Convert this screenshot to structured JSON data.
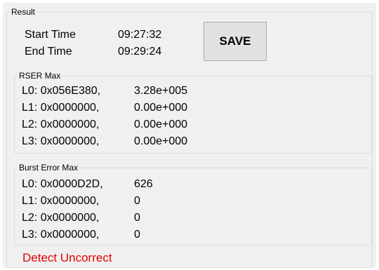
{
  "result": {
    "legend": "Result",
    "start_label": "Start Time",
    "start_value": "09:27:32",
    "end_label": "End Time",
    "end_value": "09:29:24",
    "save_label": "SAVE"
  },
  "rser": {
    "legend": "RSER Max",
    "rows": [
      {
        "addr": "L0: 0x056E380,",
        "value": "3.28e+005"
      },
      {
        "addr": "L1: 0x0000000,",
        "value": "0.00e+000"
      },
      {
        "addr": "L2: 0x0000000,",
        "value": "0.00e+000"
      },
      {
        "addr": "L3: 0x0000000,",
        "value": "0.00e+000"
      }
    ]
  },
  "burst": {
    "legend": "Burst Error Max",
    "rows": [
      {
        "addr": "L0: 0x0000D2D,",
        "value": "626"
      },
      {
        "addr": "L1: 0x0000000,",
        "value": "0"
      },
      {
        "addr": "L2: 0x0000000,",
        "value": "0"
      },
      {
        "addr": "L3: 0x0000000,",
        "value": "0"
      }
    ]
  },
  "status": {
    "text": "Detect Uncorrect",
    "color": "#e60000"
  }
}
